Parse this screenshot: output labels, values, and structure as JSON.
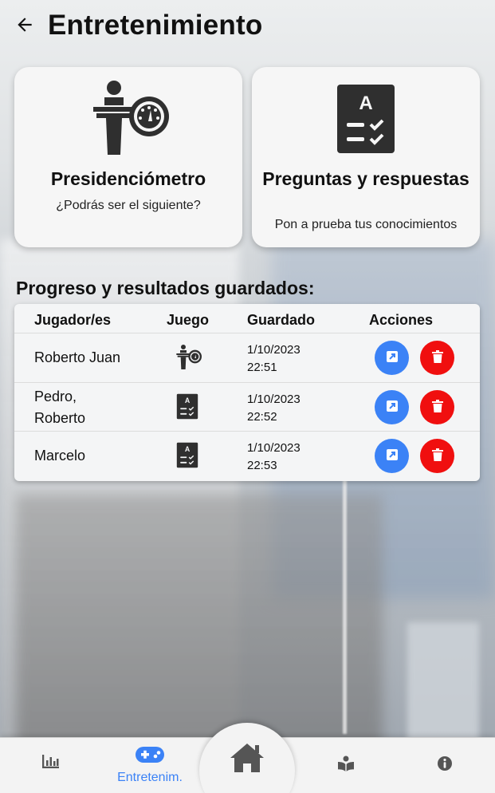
{
  "header": {
    "title": "Entretenimiento"
  },
  "cards": [
    {
      "title": "Presidenciómetro",
      "subtitle": "¿Podrás ser el siguiente?",
      "icon": "podium-gauge-icon"
    },
    {
      "title": "Preguntas y respuestas",
      "subtitle": "Pon a prueba tus conocimientos",
      "icon": "quiz-checklist-icon"
    }
  ],
  "progress": {
    "title": "Progreso y resultados guardados:",
    "columns": [
      "Jugador/es",
      "Juego",
      "Guardado",
      "Acciones"
    ],
    "rows": [
      {
        "player_line1": "Roberto Juan",
        "player_line2": "",
        "game_icon": "podium-gauge-icon",
        "date": "1/10/2023",
        "time": "22:51"
      },
      {
        "player_line1": "Pedro,",
        "player_line2": "Roberto",
        "game_icon": "quiz-checklist-icon",
        "date": "1/10/2023",
        "time": "22:52"
      },
      {
        "player_line1": "Marcelo",
        "player_line2": "",
        "game_icon": "quiz-checklist-icon",
        "date": "1/10/2023",
        "time": "22:53"
      }
    ]
  },
  "nav": {
    "items": [
      {
        "icon": "chart-icon",
        "label": ""
      },
      {
        "icon": "gamepad-icon",
        "label": "Entretenim."
      },
      {
        "icon": "home-icon",
        "label": ""
      },
      {
        "icon": "book-reader-icon",
        "label": ""
      },
      {
        "icon": "info-icon",
        "label": ""
      }
    ],
    "active_color": "#3b82f6"
  },
  "colors": {
    "edit": "#3b82f6",
    "delete": "#f00f0f",
    "icon_dark": "#2f2f2f"
  }
}
